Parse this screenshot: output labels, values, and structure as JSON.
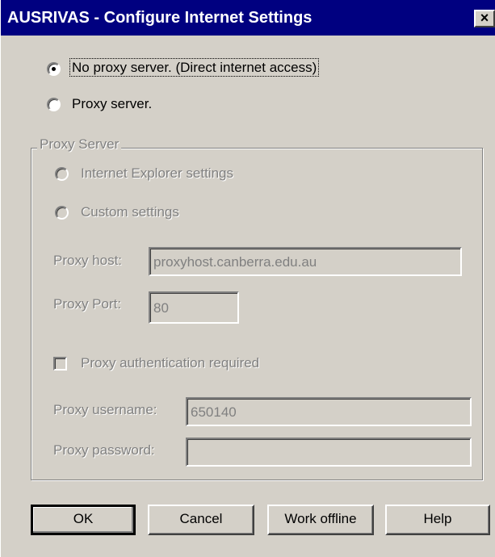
{
  "window": {
    "title": "AUSRIVAS - Configure Internet Settings",
    "close_label": "×"
  },
  "connection": {
    "no_proxy_label": "No proxy server. (Direct internet access)",
    "proxy_label": "Proxy server.",
    "selected": "no_proxy"
  },
  "proxy_group": {
    "legend": "Proxy Server",
    "ie_settings_label": "Internet Explorer settings",
    "custom_settings_label": "Custom settings",
    "host_label": "Proxy host:",
    "host_value": "proxyhost.canberra.edu.au",
    "port_label": "Proxy Port:",
    "port_value": "80",
    "auth_label": "Proxy authentication required",
    "auth_checked": false,
    "username_label": "Proxy username:",
    "username_value": "650140",
    "password_label": "Proxy password:",
    "password_value": ""
  },
  "buttons": {
    "ok": "OK",
    "cancel": "Cancel",
    "work_offline": "Work offline",
    "help": "Help"
  }
}
